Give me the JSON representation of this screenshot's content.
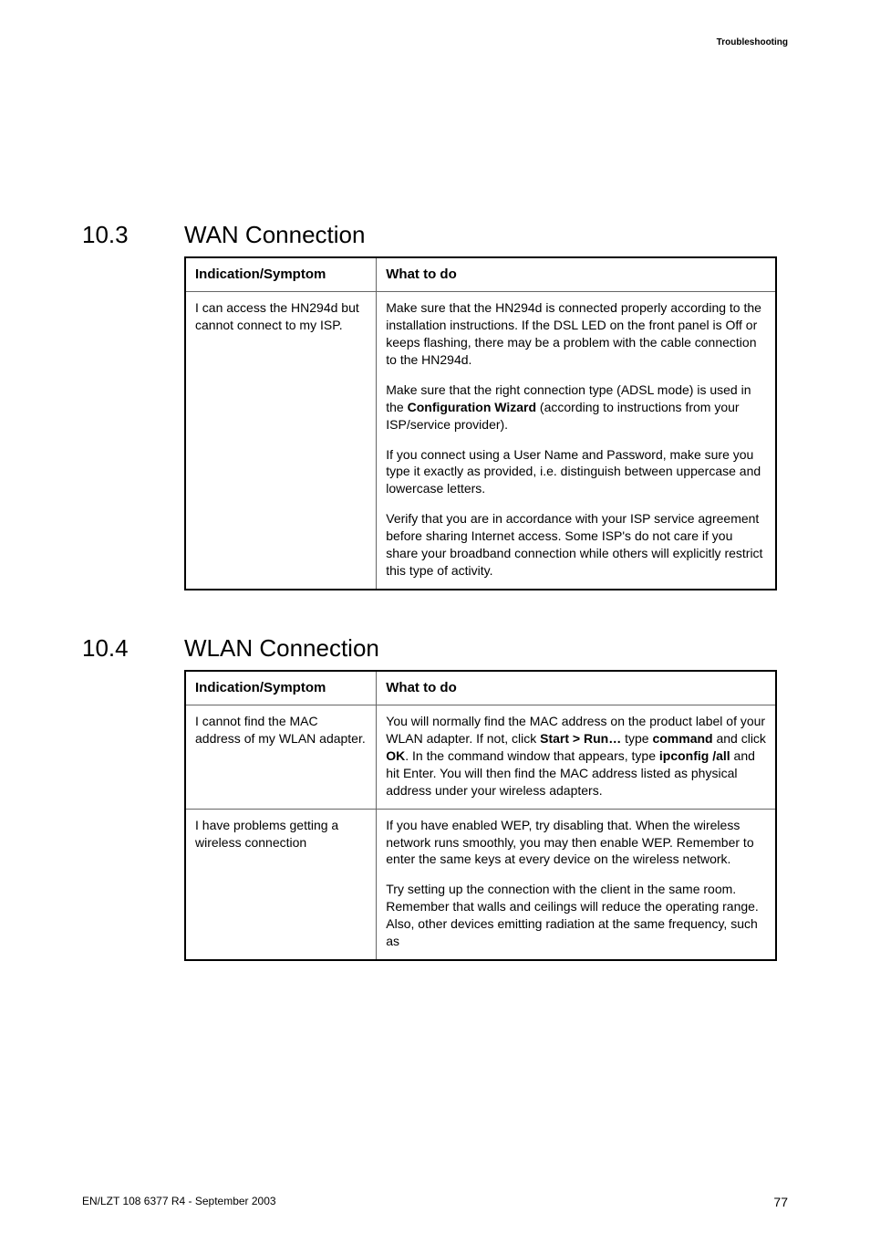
{
  "header": {
    "running": "Troubleshooting"
  },
  "sections": {
    "wan": {
      "number": "10.3",
      "title": "WAN Connection",
      "table": {
        "headers": {
          "symptom": "Indication/Symptom",
          "action": "What to do"
        },
        "row1": {
          "symptom": "I can access the HN294d but cannot connect to my ISP.",
          "action_p1": "Make sure that the HN294d is connected properly according to the installation instructions. If the DSL LED on the front panel is Off or keeps flashing, there may be a problem with the cable connection to the HN294d.",
          "action_p2_a": "Make sure that the right connection type (ADSL mode) is used in the ",
          "action_p2_b": "Configuration Wizard",
          "action_p2_c": " (according to instructions from your ISP/service provider).",
          "action_p3": "If you connect using a User Name and Password, make sure you type it exactly as provided, i.e. distinguish between uppercase and lowercase letters.",
          "action_p4": "Verify that you are in accordance with your ISP service agreement before sharing Internet access. Some ISP's do not care if you share your broadband connection while others will explicitly restrict this type of activity."
        }
      }
    },
    "wlan": {
      "number": "10.4",
      "title": "WLAN Connection",
      "table": {
        "headers": {
          "symptom": "Indication/Symptom",
          "action": "What to do"
        },
        "row1": {
          "symptom": "I cannot find the MAC address of my WLAN adapter.",
          "action_a": "You will normally find the MAC address on the product label of your WLAN adapter. If not, click ",
          "action_b1": "Start > Run…",
          "action_c": " type ",
          "action_b2": "command",
          "action_d": " and click ",
          "action_b3": "OK",
          "action_e": ". In the command window that appears, type ",
          "action_b4": "ipconfig /all",
          "action_f": " and hit Enter. You will then find the MAC address listed as physical address under your wireless adapters."
        },
        "row2": {
          "symptom": "I have problems getting a wireless connection",
          "action_p1": "If you have enabled WEP, try disabling that. When the wireless network runs smoothly, you may then enable WEP. Remember to enter the same keys at every device on the wireless network.",
          "action_p2": "Try setting up the connection with the client in the same room. Remember that walls and ceilings will reduce the operating range. Also, other devices emitting radiation at the same frequency, such as"
        }
      }
    }
  },
  "footer": {
    "left": "EN/LZT 108 6377 R4 - September 2003",
    "page": "77"
  }
}
